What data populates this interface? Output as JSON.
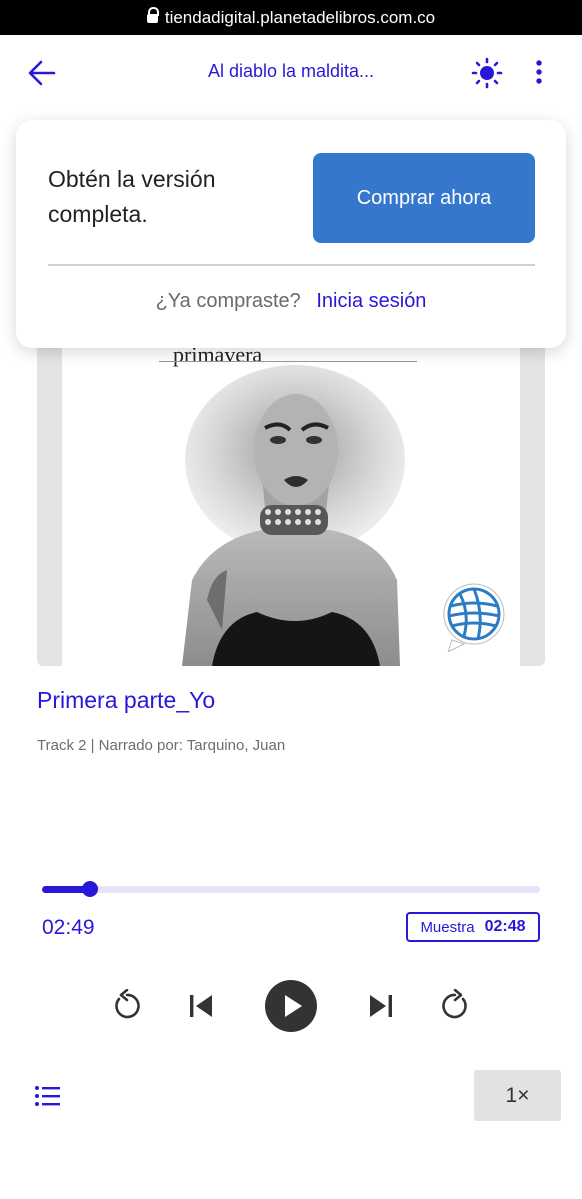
{
  "browser": {
    "url": "tiendadigital.planetadelibros.com.co"
  },
  "header": {
    "title": "Al diablo la maldita..."
  },
  "cover": {
    "visible_word": "primavera"
  },
  "purchase_popup": {
    "promo_text": "Obtén la versión completa.",
    "buy_button": "Comprar ahora",
    "already_bought": "¿Ya compraste?",
    "login_link": "Inicia sesión"
  },
  "track": {
    "title": "Primera parte_Yo",
    "meta": "Track 2 | Narrado por: Tarquino, Juan"
  },
  "player": {
    "progress": 0.097,
    "elapsed": "02:49",
    "sample_label": "Muestra",
    "sample_time": "02:48",
    "speed": "1×"
  },
  "colors": {
    "accent": "#2a18d8",
    "buy_button": "#3477cc",
    "progress_track": "#e6e3fb",
    "play_button": "#333333"
  },
  "icons": {
    "back": "arrow-left-icon",
    "theme": "sun-icon",
    "menu": "more-vertical-icon",
    "rewind": "rewind-icon",
    "previous": "skip-previous-icon",
    "play": "play-icon",
    "next": "skip-next-icon",
    "forward": "forward-icon",
    "playlist": "playlist-icon",
    "publisher": "globe-logo-icon"
  }
}
